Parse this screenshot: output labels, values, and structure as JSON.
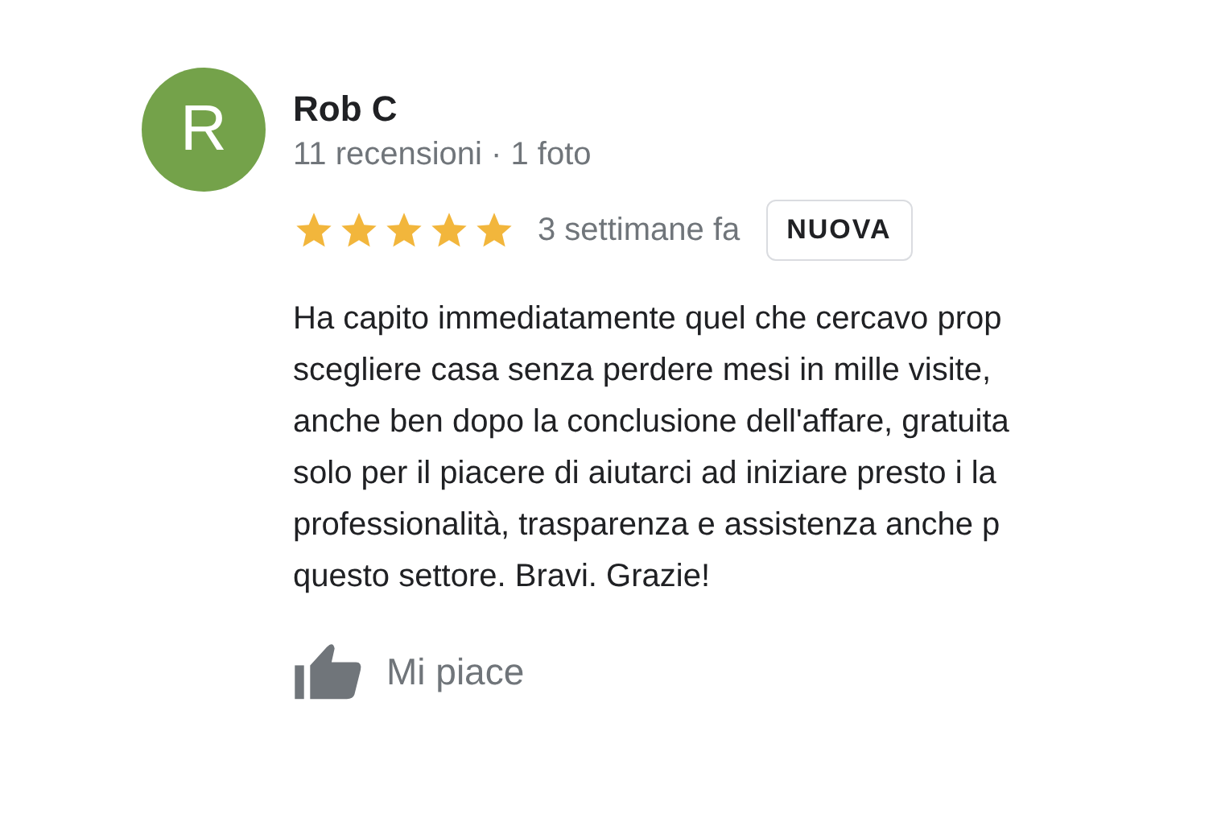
{
  "review": {
    "avatar_letter": "R",
    "author": "Rob C",
    "meta": "11 recensioni · 1 foto",
    "stars": 5,
    "time": "3 settimane fa",
    "badge": "NUOVA",
    "text_lines": [
      "Ha capito immediatamente quel che cercavo prop",
      "scegliere casa senza perdere mesi in mille visite,",
      "anche ben dopo la conclusione dell'affare, gratuita",
      "solo per il piacere di aiutarci ad iniziare presto i la",
      "professionalità, trasparenza e assistenza anche p",
      "questo settore. Bravi. Grazie!"
    ],
    "like_label": "Mi piace"
  }
}
